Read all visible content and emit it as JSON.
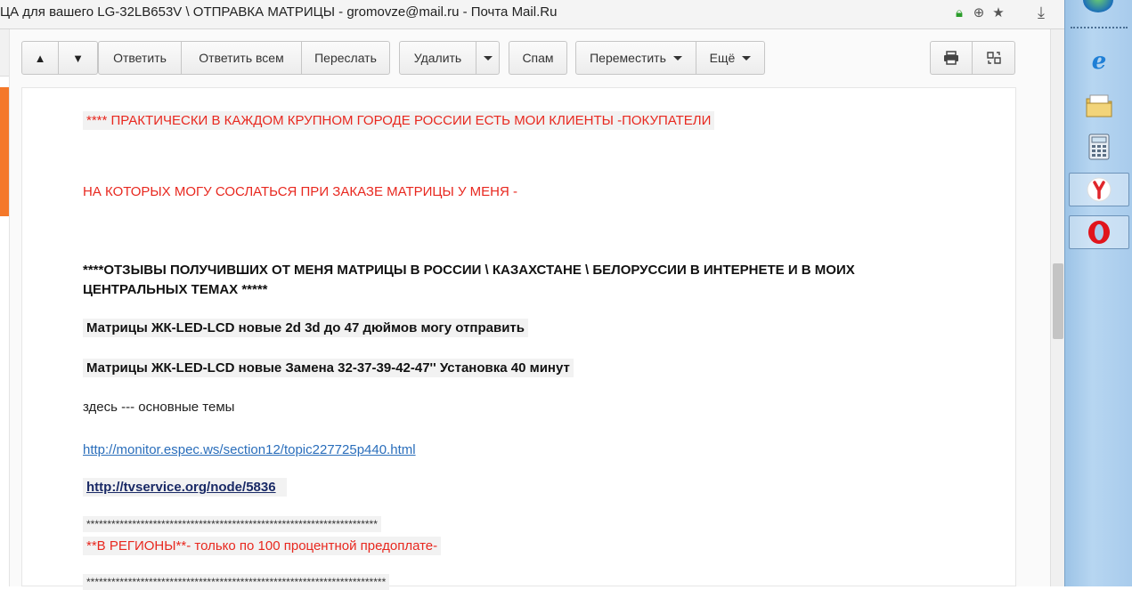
{
  "window": {
    "title": "ЦА для вашего LG-32LB653V \\ ОТПРАВКА МАТРИЦЫ - gromovze@mail.ru - Почта Mail.Ru"
  },
  "toolbar": {
    "up_arrow": "▲",
    "down_arrow": "▼",
    "reply": "Ответить",
    "reply_all": "Ответить всем",
    "forward": "Переслать",
    "delete": "Удалить",
    "spam": "Спам",
    "move": "Переместить",
    "more": "Ещё"
  },
  "message": {
    "lines": [
      "****  ПРАКТИЧЕСКИ В КАЖДОМ КРУПНОМ  ГОРОДЕ РОССИИ ЕСТЬ МОИ КЛИЕНТЫ -ПОКУПАТЕЛИ ",
      "НА КОТОРЫХ МОГУ СОСЛАТЬСЯ ПРИ ЗАКАЗЕ МАТРИЦЫ У МЕНЯ -",
      "****ОТЗЫВЫ ПОЛУЧИВШИХ ОТ МЕНЯ МАТРИЦЫ В РОССИИ \\ КАЗАХСТАНЕ \\ БЕЛОРУССИИ  В ИНТЕРНЕТЕ     И В МОИХ",
      "ЦЕНТРАЛЬНЫХ ТЕМАХ *****",
      "Матрицы ЖК-LED-LCD новые 2d 3d до 47 дюймов могу отправить",
      "Матрицы ЖК-LED-LCD новые Замена 32-37-39-42-47'' Установка 40 минут",
      "здесь --- основные темы",
      "http://monitor.espec.ws/section12/topic227725p440.html",
      "http://tvservice.org/node/5836",
      "**********************************************************************",
      "**В РЕГИОНЫ**- только по 100 процентной предоплате-",
      "************************************************************************"
    ]
  },
  "taskbar": {
    "icons": [
      "ie-icon",
      "folder-icon",
      "calculator-icon",
      "yandex-icon",
      "opera-icon"
    ]
  }
}
